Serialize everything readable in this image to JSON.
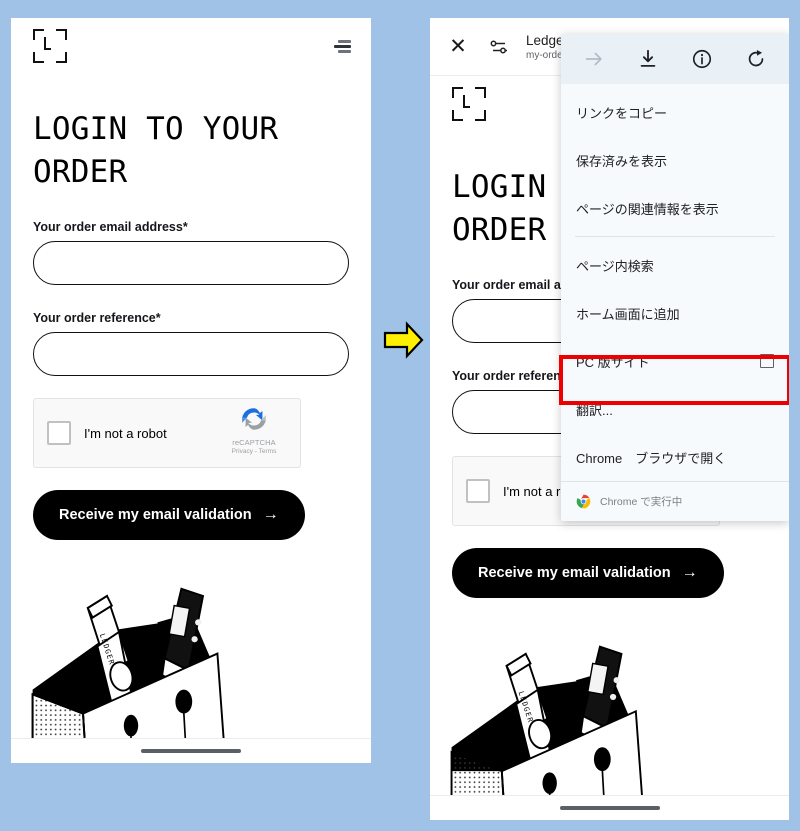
{
  "meta": {
    "background_color": "#9fc2e6",
    "highlight_color": "#ef0000",
    "arrow_color": "#ffef00"
  },
  "page": {
    "logo_name": "ledger-logo",
    "menu_icon": "hamburger-menu-icon",
    "title": "LOGIN TO YOUR ORDER",
    "title_line1": "LOGIN TO YOUR",
    "title_line2": "ORDER",
    "fields": [
      {
        "label": "Your order email address*",
        "value": "",
        "placeholder": ""
      },
      {
        "label": "Your order reference*",
        "value": "",
        "placeholder": ""
      }
    ],
    "captcha": {
      "checkbox_label": "I'm not a robot",
      "brand": "reCAPTCHA",
      "links": "Privacy - Terms",
      "checked": false
    },
    "cta": {
      "label": "Receive my email validation",
      "arrow": "→"
    },
    "illustration_name": "ledger-devices-in-box-illustration"
  },
  "right_phone": {
    "topbar": {
      "close_icon": "close-icon",
      "tune_icon": "page-settings-icon",
      "title": "Ledger -",
      "url": "my-order.le"
    },
    "menu": {
      "toolbar_icons": [
        {
          "name": "forward-arrow-icon",
          "glyph": "→",
          "disabled": true
        },
        {
          "name": "download-icon",
          "glyph": "⬇",
          "disabled": false
        },
        {
          "name": "info-icon",
          "glyph": "ⓘ",
          "disabled": false
        },
        {
          "name": "reload-icon",
          "glyph": "↻",
          "disabled": false
        }
      ],
      "items": [
        {
          "label": "リンクをコピー",
          "type": "item",
          "name": "menu-item-copy-link"
        },
        {
          "label": "保存済みを表示",
          "type": "item",
          "name": "menu-item-show-saved"
        },
        {
          "label": "ページの関連情報を表示",
          "type": "item",
          "name": "menu-item-page-info"
        },
        {
          "label": "",
          "type": "divider",
          "name": "menu-divider"
        },
        {
          "label": "ページ内検索",
          "type": "item",
          "name": "menu-item-find-in-page"
        },
        {
          "label": "ホーム画面に追加",
          "type": "item",
          "name": "menu-item-add-to-home"
        },
        {
          "label": "PC 版サイト",
          "type": "checkbox",
          "checked": false,
          "name": "menu-item-desktop-site"
        },
        {
          "label": "翻訳...",
          "type": "item",
          "highlighted": true,
          "name": "menu-item-translate"
        },
        {
          "label": "Chrome　ブラウザで開く",
          "type": "item",
          "name": "menu-item-open-in-chrome"
        }
      ],
      "footer": {
        "label": "Chrome で実行中",
        "icon": "chrome-logo-icon"
      }
    }
  }
}
